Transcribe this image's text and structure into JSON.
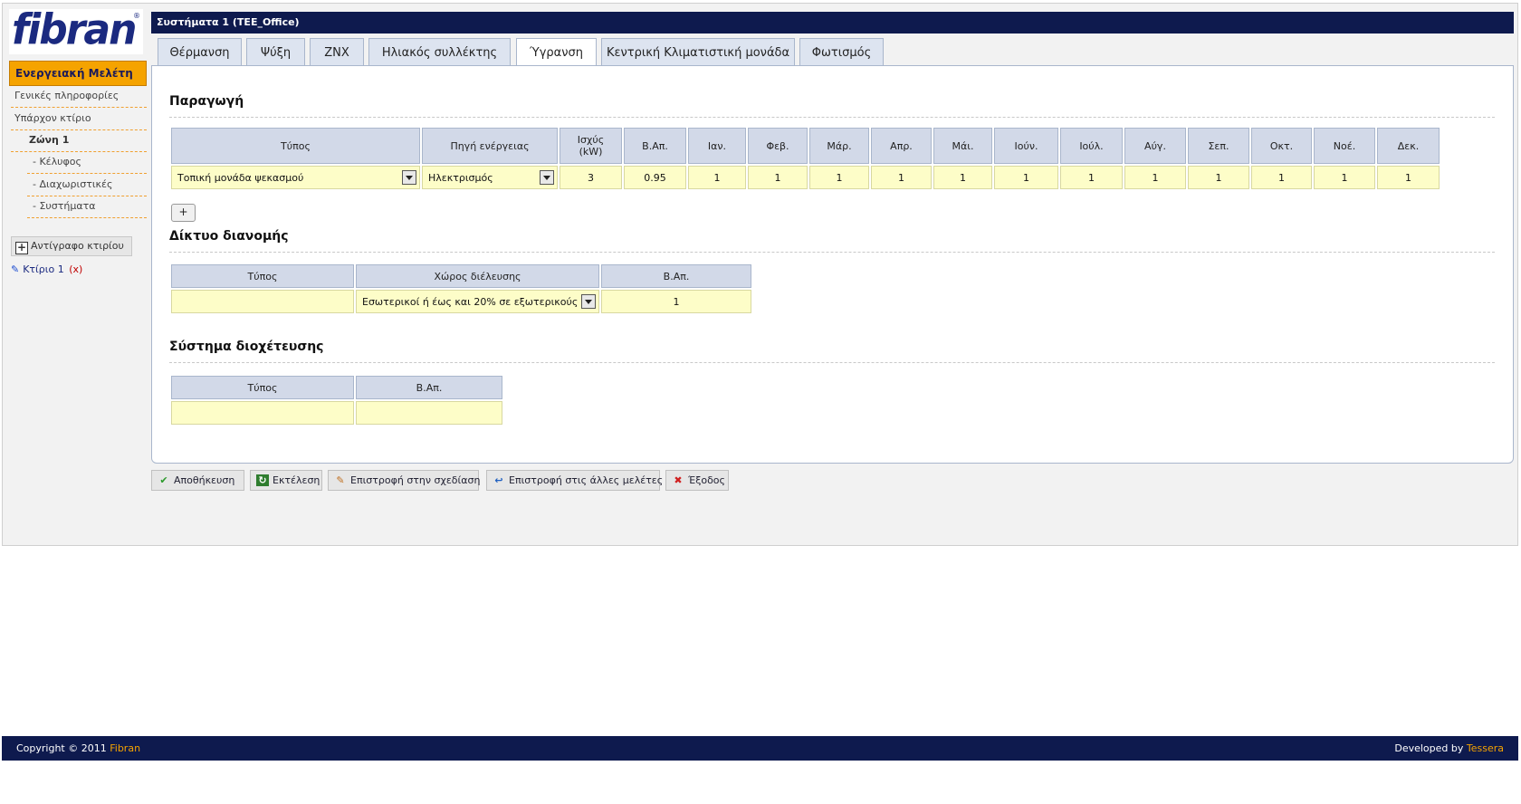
{
  "sidebar": {
    "logo_text": "fibran",
    "study_button": "Ενεργειακή Μελέτη",
    "links": [
      {
        "label": "Γενικές πληροφορίες"
      },
      {
        "label": "Υπάρχον κτίριο"
      },
      {
        "label": "Ζώνη 1"
      },
      {
        "label": "- Κέλυφος"
      },
      {
        "label": "- Διαχωριστικές"
      },
      {
        "label": "- Συστήματα"
      }
    ],
    "copy_building": "Αντίγραφο κτιρίου",
    "building": {
      "label": "Κτίριο 1",
      "delete": "(x)"
    }
  },
  "main": {
    "title": "Συστήματα 1 (TEE_Office)",
    "tabs": [
      {
        "label": "Θέρμανση"
      },
      {
        "label": "Ψύξη"
      },
      {
        "label": "ΖΝΧ"
      },
      {
        "label": "Ηλιακός συλλέκτης"
      },
      {
        "label": "Ύγρανση"
      },
      {
        "label": "Κεντρική Κλιματιστική μονάδα"
      },
      {
        "label": "Φωτισμός"
      }
    ],
    "active_tab": "Ύγρανση",
    "production": {
      "title": "Παραγωγή",
      "headers": [
        "Τύπος",
        "Πηγή ενέργειας",
        "Ισχύς (kW)",
        "Β.Απ.",
        "Ιαν.",
        "Φεβ.",
        "Μάρ.",
        "Απρ.",
        "Μάι.",
        "Ιούν.",
        "Ιούλ.",
        "Αύγ.",
        "Σεπ.",
        "Οκτ.",
        "Νοέ.",
        "Δεκ."
      ],
      "row": {
        "type": "Τοπική μονάδα ψεκασμού",
        "source": "Ηλεκτρισμός",
        "power": "3",
        "efficiency": "0.95",
        "months": [
          "1",
          "1",
          "1",
          "1",
          "1",
          "1",
          "1",
          "1",
          "1",
          "1",
          "1",
          "1"
        ]
      },
      "add_label": "+"
    },
    "distribution": {
      "title": "Δίκτυο διανομής",
      "headers": [
        "Τύπος",
        "Χώρος διέλευσης",
        "Β.Απ."
      ],
      "row": {
        "type": "",
        "space": "Εσωτερικοί ή έως και 20% σε εξωτερικούς",
        "efficiency": "1"
      }
    },
    "delivery": {
      "title": "Σύστημα διοχέτευσης",
      "headers": [
        "Τύπος",
        "Β.Απ."
      ],
      "row": {
        "type": "",
        "efficiency": ""
      }
    }
  },
  "actions": [
    {
      "label": "Αποθήκευση",
      "icon": "check-icon"
    },
    {
      "label": "Εκτέλεση",
      "icon": "run-icon"
    },
    {
      "label": "Επιστροφή στην σχεδίαση",
      "icon": "pencil-icon"
    },
    {
      "label": "Επιστροφή στις άλλες μελέτες",
      "icon": "back-arrow-icon"
    },
    {
      "label": "Έξοδος",
      "icon": "close-icon"
    }
  ],
  "footer": {
    "copyright": "Copyright © 2011 ",
    "copyright_brand": "Fibran",
    "developed": "Developed by ",
    "developer": "Tessera"
  },
  "colors": {
    "header_bar": "#0e1a4e",
    "accent_orange": "#f5a300",
    "input_cell": "#fdfdc8",
    "table_header": "#d2d9e8"
  }
}
